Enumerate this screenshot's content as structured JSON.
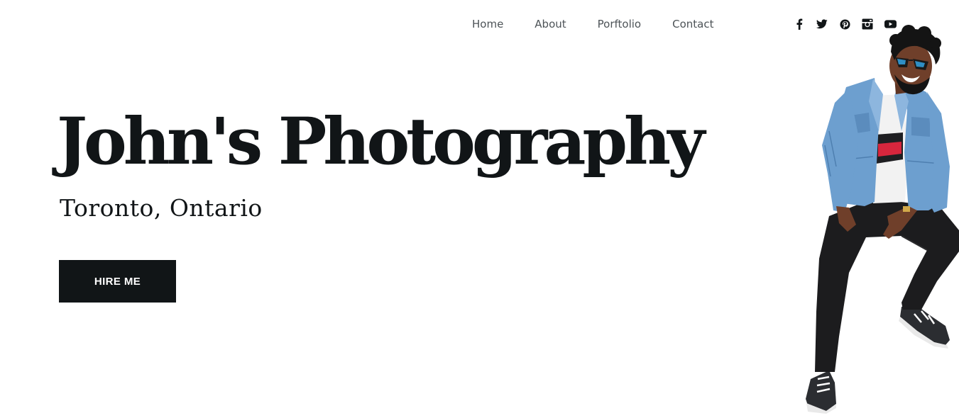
{
  "nav": {
    "links": [
      {
        "label": "Home"
      },
      {
        "label": "About"
      },
      {
        "label": "Porftolio"
      },
      {
        "label": "Contact"
      }
    ],
    "social_icons": [
      "facebook-icon",
      "twitter-icon",
      "pinterest-icon",
      "instagram-icon",
      "youtube-icon"
    ]
  },
  "hero": {
    "title": "John's Photography",
    "subtitle": "Toronto, Ontario",
    "cta_label": "HIRE ME"
  },
  "colors": {
    "text": "#111517",
    "nav_text": "#4d5357",
    "button_bg": "#111517",
    "button_text": "#ffffff",
    "jacket": "#6d9fcf",
    "pants": "#1c1c1e"
  }
}
